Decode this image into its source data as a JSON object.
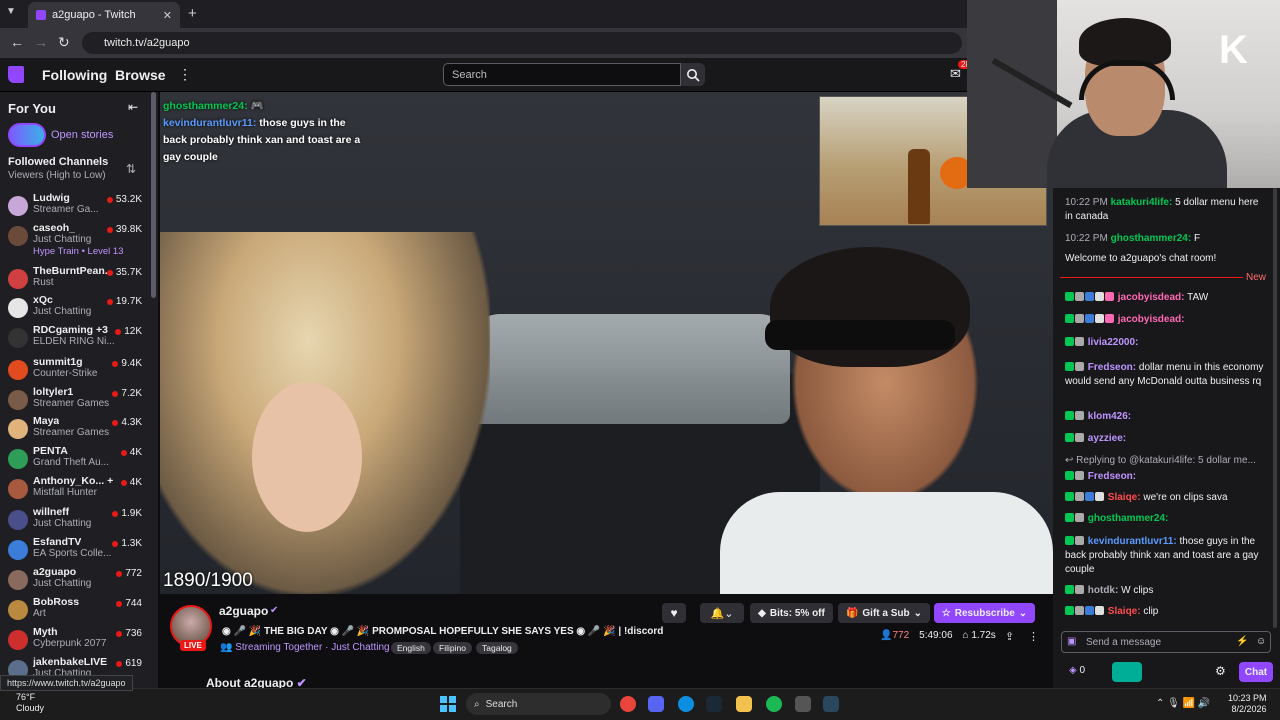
{
  "browser": {
    "tab_title": "a2guapo - Twitch",
    "url": "twitch.tv/a2guapo",
    "status_url": "https://www.twitch.tv/a2guapo"
  },
  "topnav": {
    "following": "Following",
    "browse": "Browse",
    "search_placeholder": "Search",
    "notif_count": "28"
  },
  "sidebar": {
    "for_you": "For You",
    "open_stories": "Open stories",
    "followed_header": "Followed Channels",
    "followed_sort": "Viewers (High to Low)",
    "channels": [
      {
        "name": "Ludwig",
        "game": "Streamer Ga...",
        "viewers": "53.2K",
        "color": "#c7a6d8"
      },
      {
        "name": "caseoh_",
        "game": "Just Chatting",
        "viewers": "39.8K",
        "extra": "Hype Train • Level 13",
        "color": "#6b4a3a"
      },
      {
        "name": "TheBurntPean...",
        "game": "Rust",
        "viewers": "35.7K",
        "color": "#d04040"
      },
      {
        "name": "xQc",
        "game": "Just Chatting",
        "viewers": "19.7K",
        "color": "#e6e6e6"
      },
      {
        "name": "RDCgaming +3",
        "game": "ELDEN RING Ni...",
        "viewers": "12K",
        "color": "#333"
      },
      {
        "name": "summit1g",
        "game": "Counter-Strike",
        "viewers": "9.4K",
        "color": "#e24b1e"
      },
      {
        "name": "loltyler1",
        "game": "Streamer Games",
        "viewers": "7.2K",
        "color": "#7a5b48"
      },
      {
        "name": "Maya",
        "game": "Streamer Games",
        "viewers": "4.3K",
        "color": "#e0b37d"
      },
      {
        "name": "PENTA",
        "game": "Grand Theft Au...",
        "viewers": "4K",
        "color": "#2f9d58"
      },
      {
        "name": "Anthony_Ko... +2",
        "game": "Mistfall Hunter",
        "viewers": "4K",
        "color": "#a85a3e"
      },
      {
        "name": "willneff",
        "game": "Just Chatting",
        "viewers": "1.9K",
        "color": "#4a4f8c"
      },
      {
        "name": "EsfandTV",
        "game": "EA Sports Colle...",
        "viewers": "1.3K",
        "color": "#3b7dd8"
      },
      {
        "name": "a2guapo",
        "game": "Just Chatting",
        "viewers": "772",
        "color": "#8a6a5c"
      },
      {
        "name": "BobRoss",
        "game": "Art",
        "viewers": "744",
        "color": "#b9893f"
      },
      {
        "name": "Myth",
        "game": "Cyberpunk 2077",
        "viewers": "736",
        "color": "#cf2e2e"
      },
      {
        "name": "jakenbakeLIVE",
        "game": "Just Chatting",
        "viewers": "619",
        "color": "#5b6f8c"
      }
    ]
  },
  "video": {
    "overlay_counter": "1890/1900",
    "overlay_chat": [
      {
        "user": "ghosthammer24:",
        "text": ""
      },
      {
        "user": "kevindurantluvr11:",
        "text": "those guys in the back probably think xan and toast are a gay couple"
      }
    ]
  },
  "stream": {
    "name": "a2guapo",
    "live": "LIVE",
    "title": "THE BIG DAY 🎉 PROMPOSAL HOPEFULLY SHE SAYS YES 🎉 | !discord",
    "title_a": "THE BIG DAY",
    "title_b": "PROMPOSAL HOPEFULLY SHE SAYS YES",
    "title_c": "| !discord",
    "together": "Streaming Together · Just Chatting",
    "tags": [
      "English",
      "Filipino",
      "Tagalog"
    ],
    "bits": "Bits: 5% off",
    "gift": "Gift a Sub",
    "resub": "Resubscribe",
    "viewers": "772",
    "uptime": "5:49:06",
    "followers": "1.72s",
    "about": "About a2guapo"
  },
  "chat": {
    "lines_before": [
      {
        "time": "10:22 PM",
        "user": "katakuri4life:",
        "text": "5 dollar menu here in canada",
        "color": "#00c853"
      },
      {
        "time": "10:22 PM",
        "user": "ghosthammer24:",
        "text": "F",
        "color": "#00c853"
      }
    ],
    "welcome": "Welcome to a2guapo's chat room!",
    "new_label": "New",
    "messages": [
      {
        "user": "jacobyisdead:",
        "text": "TAW",
        "color": "#ff69b4"
      },
      {
        "user": "jacobyisdead:",
        "text": "",
        "color": "#ff69b4"
      },
      {
        "user": "livia22000:",
        "text": "",
        "color": "#bf94ff"
      },
      {
        "user": "Fredseon:",
        "text": "dollar menu in this economy would send any McDonald outta business rq",
        "color": "#bf94ff"
      },
      {
        "user": "klom426:",
        "text": "",
        "color": "#bf94ff"
      },
      {
        "user": "ayzziee:",
        "text": "",
        "color": "#bf94ff"
      },
      {
        "reply": "Replying to @katakuri4life: 5 dollar me..."
      },
      {
        "user": "Fredseon:",
        "text": "",
        "color": "#bf94ff"
      },
      {
        "user": "Slaiqe:",
        "text": "we're on clips sava",
        "color": "#ff4d4d"
      },
      {
        "user": "ghosthammer24:",
        "text": "",
        "color": "#00c853"
      },
      {
        "user": "kevindurantluvr11:",
        "text": "those guys in the back probably think xan and toast are a gay couple",
        "color": "#5b9bff"
      },
      {
        "user": "hotdk:",
        "text": "W clips",
        "color": "#adadb8"
      },
      {
        "user": "Slaiqe:",
        "text": "clip",
        "color": "#ff4d4d"
      }
    ],
    "input_placeholder": "Send a message",
    "points": "0",
    "chat_button": "Chat"
  },
  "taskbar": {
    "weather_temp": "76°F",
    "weather_desc": "Cloudy",
    "search": "Search",
    "time": "10:23 PM",
    "date": "8/2/2026"
  }
}
